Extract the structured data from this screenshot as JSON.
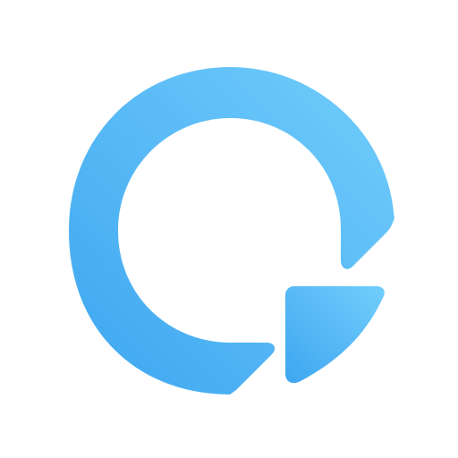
{
  "logo": {
    "icon": "q-ring-logo-icon",
    "colors": {
      "gradient_start": "#3ea6f0",
      "gradient_end": "#72cdfb",
      "background": "#ffffff"
    }
  }
}
